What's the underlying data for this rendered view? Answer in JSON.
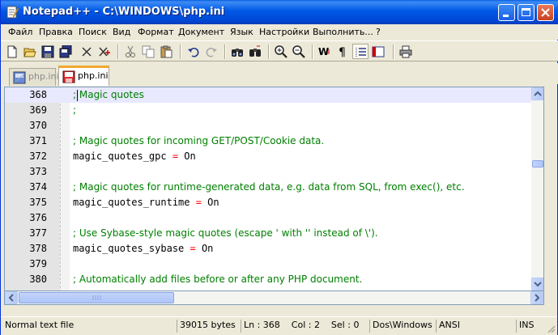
{
  "window": {
    "title": "Notepad++ - C:\\WINDOWS\\php.ini"
  },
  "menu": [
    "Файл",
    "Правка",
    "Поиск",
    "Вид",
    "Формат",
    "Документ",
    "Язык",
    "Настройки",
    "Выполнить...",
    "?"
  ],
  "tabs": [
    {
      "label": "php.ini",
      "active": false
    },
    {
      "label": "php.ini",
      "active": true
    }
  ],
  "editor": {
    "current_line": "368",
    "lines": [
      {
        "num": "368",
        "parts": [
          {
            "t": "; Magic quotes",
            "c": "comment"
          }
        ]
      },
      {
        "num": "369",
        "parts": [
          {
            "t": ";",
            "c": "comment"
          }
        ]
      },
      {
        "num": "370",
        "parts": []
      },
      {
        "num": "371",
        "parts": [
          {
            "t": "; Magic quotes for incoming GET/POST/Cookie data.",
            "c": "comment"
          }
        ]
      },
      {
        "num": "372",
        "parts": [
          {
            "t": "magic_quotes_gpc ",
            "c": ""
          },
          {
            "t": "=",
            "c": "op"
          },
          {
            "t": " On",
            "c": ""
          }
        ]
      },
      {
        "num": "373",
        "parts": []
      },
      {
        "num": "374",
        "parts": [
          {
            "t": "; Magic quotes for runtime-generated data, e.g. data from SQL, from exec(), etc.",
            "c": "comment"
          }
        ]
      },
      {
        "num": "375",
        "parts": [
          {
            "t": "magic_quotes_runtime ",
            "c": ""
          },
          {
            "t": "=",
            "c": "op"
          },
          {
            "t": " On",
            "c": ""
          }
        ]
      },
      {
        "num": "376",
        "parts": []
      },
      {
        "num": "377",
        "parts": [
          {
            "t": "; Use Sybase-style magic quotes (escape ' with '' instead of \\').",
            "c": "comment"
          }
        ]
      },
      {
        "num": "378",
        "parts": [
          {
            "t": "magic_quotes_sybase ",
            "c": ""
          },
          {
            "t": "=",
            "c": "op"
          },
          {
            "t": " On",
            "c": ""
          }
        ]
      },
      {
        "num": "379",
        "parts": []
      },
      {
        "num": "380",
        "parts": [
          {
            "t": "; Automatically add files before or after any PHP document.",
            "c": "comment"
          }
        ]
      }
    ]
  },
  "status": {
    "file_type": "Normal text file",
    "size": "39015 bytes",
    "position": "Ln : 368    Col : 2    Sel : 0",
    "eol": "Dos\\Windows",
    "encoding": "ANSI",
    "mode": "INS"
  },
  "colors": {
    "comment": "#008000",
    "operator": "#ff0000",
    "current_line": "#e8e8ff",
    "title_bar": "#0058e6"
  }
}
